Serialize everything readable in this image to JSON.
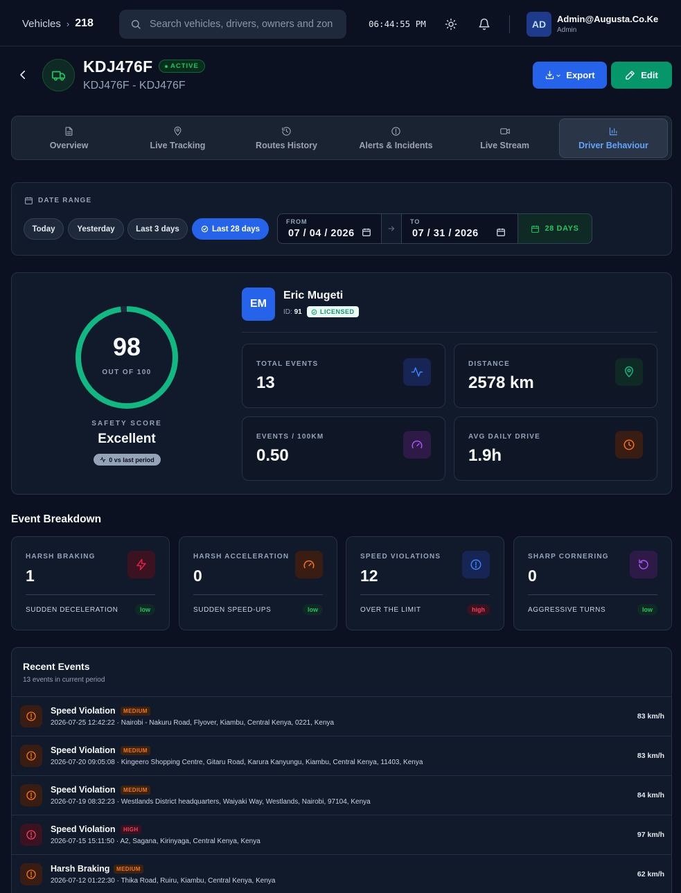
{
  "topbar": {
    "breadcrumb": "Vehicles",
    "count": "218",
    "search_placeholder": "Search vehicles, drivers, owners and zones",
    "clock": "06:44:55 PM",
    "user": {
      "initials": "AD",
      "name": "Admin@Augusta.Co.Ke",
      "role": "Admin"
    }
  },
  "header": {
    "plate": "KDJ476F",
    "status": "ACTIVE",
    "subtitle": "KDJ476F - KDJ476F",
    "export_label": "Export",
    "edit_label": "Edit"
  },
  "tabs": [
    {
      "label": "Overview",
      "icon": "document-icon"
    },
    {
      "label": "Live Tracking",
      "icon": "map-pin-icon"
    },
    {
      "label": "Routes History",
      "icon": "history-icon"
    },
    {
      "label": "Alerts & Incidents",
      "icon": "alert-circle-icon"
    },
    {
      "label": "Live Stream",
      "icon": "video-icon"
    },
    {
      "label": "Driver Behaviour",
      "icon": "bar-chart-icon",
      "active": true
    }
  ],
  "date_range": {
    "title": "DATE RANGE",
    "presets": [
      "Today",
      "Yesterday",
      "Last 3 days",
      "Last 28 days"
    ],
    "active_preset": "Last 28 days",
    "from_label": "FROM",
    "from": "07 / 04 / 2026",
    "to_label": "TO",
    "to": "07 / 31 / 2026",
    "days": "28 DAYS"
  },
  "score": {
    "value": "98",
    "out_of": "OUT OF 100",
    "label": "SAFETY SCORE",
    "rating": "Excellent",
    "trend": "0 vs last period",
    "fraction": 0.98,
    "color": "#10b981"
  },
  "driver": {
    "initials": "EM",
    "name": "Eric Mugeti",
    "id_label": "ID:",
    "id": "91",
    "license": "LICENSED"
  },
  "stats": [
    {
      "label": "TOTAL EVENTS",
      "value": "13",
      "icon": "activity-icon",
      "color": "#3b82f6"
    },
    {
      "label": "DISTANCE",
      "value": "2578 km",
      "icon": "map-pin-icon",
      "color": "#10b981"
    },
    {
      "label": "EVENTS / 100KM",
      "value": "0.50",
      "icon": "gauge-icon",
      "color": "#a855f7"
    },
    {
      "label": "AVG DAILY DRIVE",
      "value": "1.9h",
      "icon": "clock-icon",
      "color": "#f97316"
    }
  ],
  "breakdown": {
    "title": "Event Breakdown",
    "items": [
      {
        "label": "HARSH BRAKING",
        "value": "1",
        "desc": "SUDDEN DECELERATION",
        "severity": "low",
        "icon": "lightning-icon",
        "color": "#e11d48"
      },
      {
        "label": "HARSH ACCELERATION",
        "value": "0",
        "desc": "SUDDEN SPEED-UPS",
        "severity": "low",
        "icon": "gauge-icon",
        "color": "#f97316"
      },
      {
        "label": "SPEED VIOLATIONS",
        "value": "12",
        "desc": "OVER THE LIMIT",
        "severity": "high",
        "icon": "alert-circle-icon",
        "color": "#3b82f6"
      },
      {
        "label": "SHARP CORNERING",
        "value": "0",
        "desc": "AGGRESSIVE TURNS",
        "severity": "low",
        "icon": "rotate-icon",
        "color": "#a855f7"
      }
    ]
  },
  "recent": {
    "title": "Recent Events",
    "subtitle": "13 events in current period",
    "events": [
      {
        "title": "Speed Violation",
        "severity": "MEDIUM",
        "details": "2026-07-25 12:42:22 · Nairobi - Nakuru Road, Flyover, Kiambu, Central Kenya, 0221, Kenya",
        "speed": "83 km/h"
      },
      {
        "title": "Speed Violation",
        "severity": "MEDIUM",
        "details": "2026-07-20 09:05:08 · Kingeero Shopping Centre, Gitaru Road, Karura Kanyungu, Kiambu, Central Kenya, 11403, Kenya",
        "speed": "83 km/h"
      },
      {
        "title": "Speed Violation",
        "severity": "MEDIUM",
        "details": "2026-07-19 08:32:23 · Westlands District headquarters, Waiyaki Way, Westlands, Nairobi, 97104, Kenya",
        "speed": "84 km/h"
      },
      {
        "title": "Speed Violation",
        "severity": "HIGH",
        "details": "2026-07-15 15:11:50 · A2, Sagana, Kirinyaga, Central Kenya, Kenya",
        "speed": "97 km/h"
      },
      {
        "title": "Harsh Braking",
        "severity": "MEDIUM",
        "details": "2026-07-12 01:22:30 · Thika Road, Ruiru, Kiambu, Central Kenya, Kenya",
        "speed": "62 km/h"
      }
    ]
  }
}
